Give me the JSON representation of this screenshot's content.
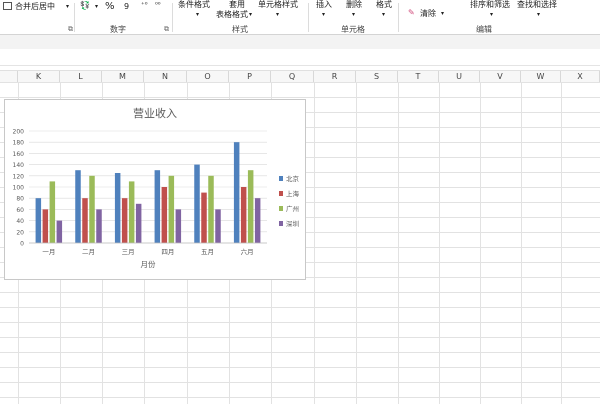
{
  "ribbon": {
    "merge_center": "合并后居中",
    "percent_symbol": "%",
    "thousands_sep": "9",
    "decimals": "⁰⁰",
    "conditional_format": "条件格式",
    "apply": "套用",
    "table_format": "表格格式",
    "cell_styles": "单元格样式",
    "insert": "插入",
    "delete": "删除",
    "format": "格式",
    "clear": "清除",
    "sort_filter": "排序和筛选",
    "find_select": "查找和选择",
    "groups": {
      "number": "数字",
      "styles": "样式",
      "cells": "单元格",
      "editing": "编辑"
    }
  },
  "columns": [
    "K",
    "L",
    "M",
    "N",
    "O",
    "P",
    "Q",
    "R",
    "S",
    "T",
    "U",
    "V",
    "W",
    "X"
  ],
  "icons": {
    "merge": "merge-cells-icon",
    "currency": "currency-icon",
    "eraser": "eraser-icon"
  },
  "colors": {
    "series": [
      "#4f81bd",
      "#c0504d",
      "#9bbb59",
      "#8064a2"
    ]
  },
  "chart_data": {
    "type": "bar",
    "title": "营业收入",
    "xlabel": "月份",
    "ylabel": "",
    "categories": [
      "一月",
      "二月",
      "三月",
      "四月",
      "五月",
      "六月"
    ],
    "ylim": [
      0,
      200
    ],
    "yticks": [
      0,
      20,
      40,
      60,
      80,
      100,
      120,
      140,
      160,
      180,
      200
    ],
    "grid": true,
    "legend_position": "right",
    "series": [
      {
        "name": "北京",
        "values": [
          80,
          130,
          125,
          130,
          140,
          180
        ]
      },
      {
        "name": "上海",
        "values": [
          60,
          80,
          80,
          100,
          90,
          100
        ]
      },
      {
        "name": "广州",
        "values": [
          110,
          120,
          110,
          120,
          120,
          130
        ]
      },
      {
        "name": "深圳",
        "values": [
          40,
          60,
          70,
          60,
          60,
          80
        ]
      }
    ]
  }
}
